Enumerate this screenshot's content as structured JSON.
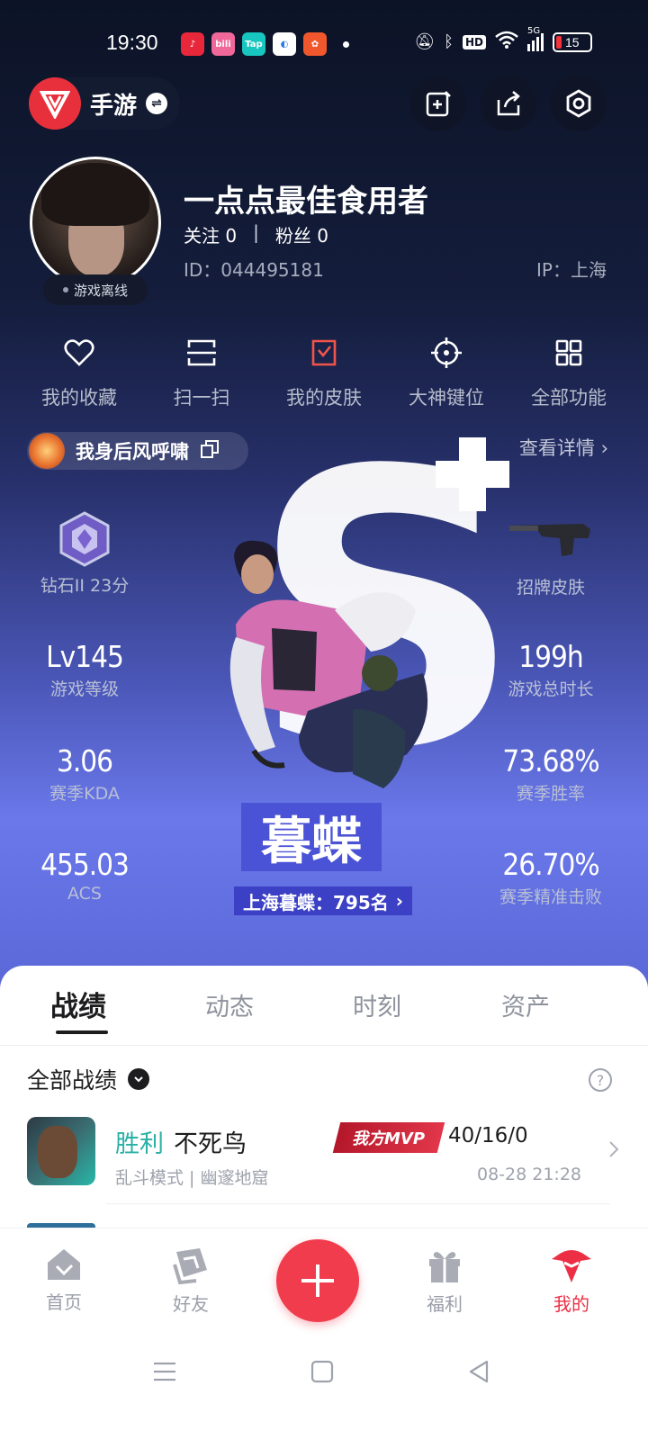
{
  "status_bar": {
    "time": "19:30",
    "app_icons": [
      "music-app-icon",
      "bilibili-app-icon",
      "taptap-app-icon",
      "browser-app-icon",
      "game-app-icon"
    ],
    "taptap_label": "Tap",
    "bilibili_label": "bili",
    "battery_level": "15",
    "network": "5G",
    "hd_label": "HD"
  },
  "header": {
    "game_name": "手游",
    "buttons": [
      "edit-card-icon",
      "share-icon",
      "settings-hexagon-icon"
    ]
  },
  "profile": {
    "nickname": "一点点最佳食用者",
    "following_label": "关注 0",
    "separator": "|",
    "followers_label": "粉丝 0",
    "id_label": "ID：044495181",
    "ip_label": "IP：上海",
    "status": "游戏离线"
  },
  "shortcuts": [
    {
      "label": "我的收藏",
      "icon": "heart-icon"
    },
    {
      "label": "扫一扫",
      "icon": "scan-icon"
    },
    {
      "label": "我的皮肤",
      "icon": "skin-icon"
    },
    {
      "label": "大神键位",
      "icon": "crosshair-icon"
    },
    {
      "label": "全部功能",
      "icon": "grid-icon"
    }
  ],
  "team": {
    "name": "我身后风呼啸",
    "view_detail": "查看详情"
  },
  "stats": {
    "rank": {
      "value": "钻石II 23分",
      "label": "钻石II 23分"
    },
    "signature_skin": {
      "label": "招牌皮肤"
    },
    "level": {
      "value": "Lv145",
      "label": "游戏等级"
    },
    "playtime": {
      "value": "199h",
      "label": "游戏总时长"
    },
    "kda": {
      "value": "3.06",
      "label": "赛季KDA"
    },
    "winrate": {
      "value": "73.68%",
      "label": "赛季胜率"
    },
    "acs": {
      "value": "455.03",
      "label": "ACS"
    },
    "precision": {
      "value": "26.70%",
      "label": "赛季精准击败"
    }
  },
  "hero": {
    "grade_letter": "S",
    "character_name": "暮蝶",
    "ranking": "上海暮蝶：795名"
  },
  "tabs": [
    {
      "label": "战绩",
      "active": true
    },
    {
      "label": "动态",
      "active": false
    },
    {
      "label": "时刻",
      "active": false
    },
    {
      "label": "资产",
      "active": false
    }
  ],
  "records": {
    "filter_label": "全部战绩",
    "matches": [
      {
        "result": "胜利",
        "hero": "不死鸟",
        "badge": "我方MVP",
        "kda": "40/16/0",
        "mode": "乱斗模式 | 幽邃地窟",
        "time": "08-28 21:28"
      }
    ]
  },
  "bottom_nav": [
    {
      "label": "首页",
      "icon": "home-icon"
    },
    {
      "label": "好友",
      "icon": "friends-icon"
    },
    {
      "label": "",
      "icon": "plus-icon"
    },
    {
      "label": "福利",
      "icon": "gift-icon"
    },
    {
      "label": "我的",
      "icon": "profile-icon",
      "active": true
    }
  ],
  "colors": {
    "accent_red": "#ec2f45",
    "win_green": "#2ab0a5",
    "hero_bg": "#5a67d6"
  }
}
